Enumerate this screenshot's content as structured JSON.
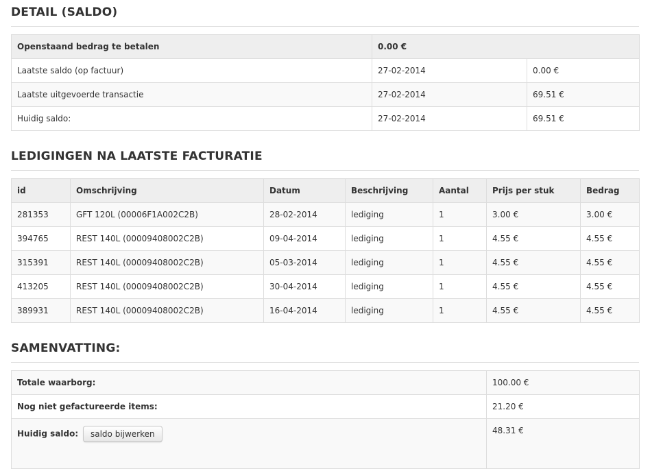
{
  "detail": {
    "title": "DETAIL (SALDO)",
    "outstanding_label": "Openstaand bedrag te betalen",
    "outstanding_value": "0.00 €",
    "rows": [
      {
        "label": "Laatste saldo (op factuur)",
        "date": "27-02-2014",
        "amount": "0.00 €"
      },
      {
        "label": "Laatste uitgevoerde transactie",
        "date": "27-02-2014",
        "amount": "69.51 €"
      },
      {
        "label": "Huidig saldo:",
        "date": "27-02-2014",
        "amount": "69.51 €"
      }
    ]
  },
  "ledigingen": {
    "title": "LEDIGINGEN NA LAATSTE FACTURATIE",
    "headers": {
      "id": "id",
      "omschrijving": "Omschrijving",
      "datum": "Datum",
      "beschrijving": "Beschrijving",
      "aantal": "Aantal",
      "prijs": "Prijs per stuk",
      "bedrag": "Bedrag"
    },
    "rows": [
      {
        "id": "281353",
        "omschrijving": "GFT 120L (00006F1A002C2B)",
        "datum": "28-02-2014",
        "beschrijving": "lediging",
        "aantal": "1",
        "prijs": "3.00 €",
        "bedrag": "3.00 €"
      },
      {
        "id": "394765",
        "omschrijving": "REST 140L (00009408002C2B)",
        "datum": "09-04-2014",
        "beschrijving": "lediging",
        "aantal": "1",
        "prijs": "4.55 €",
        "bedrag": "4.55 €"
      },
      {
        "id": "315391",
        "omschrijving": "REST 140L (00009408002C2B)",
        "datum": "05-03-2014",
        "beschrijving": "lediging",
        "aantal": "1",
        "prijs": "4.55 €",
        "bedrag": "4.55 €"
      },
      {
        "id": "413205",
        "omschrijving": "REST 140L (00009408002C2B)",
        "datum": "30-04-2014",
        "beschrijving": "lediging",
        "aantal": "1",
        "prijs": "4.55 €",
        "bedrag": "4.55 €"
      },
      {
        "id": "389931",
        "omschrijving": "REST 140L (00009408002C2B)",
        "datum": "16-04-2014",
        "beschrijving": "lediging",
        "aantal": "1",
        "prijs": "4.55 €",
        "bedrag": "4.55 €"
      }
    ]
  },
  "samenvatting": {
    "title": "SAMENVATTING:",
    "waarborg_label": "Totale waarborg:",
    "waarborg_value": "100.00 €",
    "niet_gefactureerd_label": "Nog niet gefactureerde items:",
    "niet_gefactureerd_value": "21.20 €",
    "huidig_label": "Huidig saldo:",
    "huidig_value": "48.31 €",
    "update_button_label": "saldo bijwerken"
  }
}
